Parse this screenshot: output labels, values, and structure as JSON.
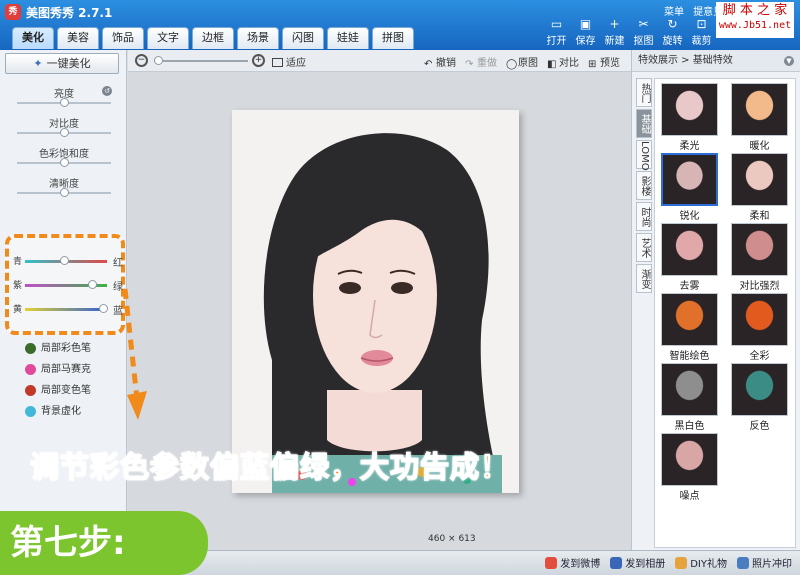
{
  "app": {
    "title": "美图秀秀 2.7.1",
    "logo": "秀",
    "top_links": [
      "菜单",
      "提意见"
    ]
  },
  "watermark": {
    "line1": "脚 本 之 家",
    "line2": "www.Jb51.net"
  },
  "tabs": [
    "美化",
    "美容",
    "饰品",
    "文字",
    "边框",
    "场景",
    "闪图",
    "娃娃",
    "拼图"
  ],
  "tools": [
    {
      "label": "打开",
      "icon": "folder-icon"
    },
    {
      "label": "保存",
      "icon": "save-icon"
    },
    {
      "label": "新建",
      "icon": "new-icon"
    },
    {
      "label": "抠图",
      "icon": "cutout-icon"
    },
    {
      "label": "旋转",
      "icon": "rotate-icon"
    },
    {
      "label": "裁剪",
      "icon": "crop-icon"
    }
  ],
  "left": {
    "one_key": "一键美化",
    "sliders": [
      {
        "label": "亮度",
        "value": 0.5
      },
      {
        "label": "对比度",
        "value": 0.5
      },
      {
        "label": "色彩饱和度",
        "value": 0.5
      },
      {
        "label": "清晰度",
        "value": 0.5
      }
    ],
    "color_sliders": [
      {
        "left": "青",
        "right": "红",
        "value": 0.48
      },
      {
        "left": "紫",
        "right": "绿",
        "value": 0.82
      },
      {
        "left": "黄",
        "right": "蓝",
        "value": 0.95
      }
    ],
    "brushes": [
      {
        "label": "局部彩色笔",
        "color": "#3a6b2a"
      },
      {
        "label": "局部马赛克",
        "color": "#e04a9a"
      },
      {
        "label": "局部变色笔",
        "color": "#c0392b"
      },
      {
        "label": "背景虚化",
        "color": "#42b7d8"
      }
    ]
  },
  "canvas": {
    "fit_label": "适应",
    "edit_buttons": [
      {
        "label": "撤销",
        "enabled": true
      },
      {
        "label": "重做",
        "enabled": false
      },
      {
        "label": "原图",
        "enabled": true
      },
      {
        "label": "对比",
        "enabled": true
      },
      {
        "label": "预览",
        "enabled": true
      }
    ],
    "dimensions": "460 × 613"
  },
  "annotation": {
    "caption": "调节彩色参数偏蓝偏绿，大功告成！",
    "step": "第七步:",
    "accent": "#f08a1a"
  },
  "right": {
    "breadcrumb": "特效展示 > 基础特效",
    "vtabs": [
      "热门",
      "基础",
      "LOMO",
      "影楼",
      "时尚",
      "艺术",
      "渐变"
    ],
    "active_vtab": 1,
    "effects": [
      {
        "label": "柔光",
        "tint": "#e8c8c8"
      },
      {
        "label": "暖化",
        "tint": "#f2b98a"
      },
      {
        "label": "锐化",
        "tint": "#d8b5b5",
        "selected": true
      },
      {
        "label": "柔和",
        "tint": "#ecc9c0"
      },
      {
        "label": "去雾",
        "tint": "#e0a8a8"
      },
      {
        "label": "对比强烈",
        "tint": "#cf8d8d"
      },
      {
        "label": "智能绘色",
        "tint": "#e0702a"
      },
      {
        "label": "全彩",
        "tint": "#e35a1f"
      },
      {
        "label": "黑白色",
        "tint": "#8e8e8e"
      },
      {
        "label": "反色",
        "tint": "#3c8c86"
      },
      {
        "label": "噪点",
        "tint": "#d9a6a6"
      }
    ]
  },
  "status": {
    "links": [
      {
        "label": "发到微博",
        "color": "#e24d3c"
      },
      {
        "label": "发到相册",
        "color": "#3a66b7"
      },
      {
        "label": "DIY礼物",
        "color": "#e6a23c"
      },
      {
        "label": "照片冲印",
        "color": "#4a7cc0"
      }
    ]
  }
}
